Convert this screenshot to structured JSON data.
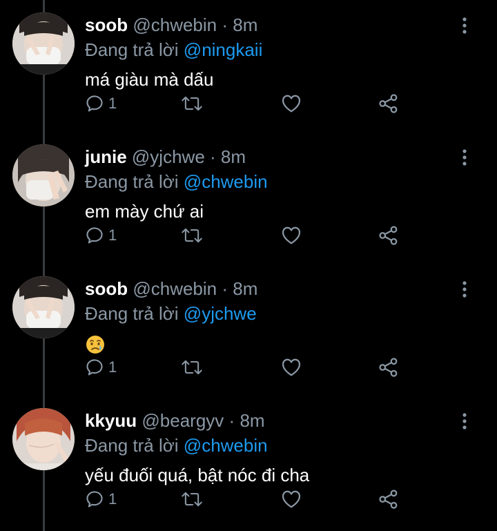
{
  "tweets": [
    {
      "name": "soob",
      "handle": "@chwebin",
      "separator": "·",
      "time": "8m",
      "reply_prefix": "Đang trả lời",
      "reply_to": "@ningkaii",
      "text": "má giàu mà dấu",
      "reply_count": "1",
      "avatar": "soob-avatar"
    },
    {
      "name": "junie",
      "handle": "@yjchwe",
      "separator": "·",
      "time": "8m",
      "reply_prefix": "Đang trả lời",
      "reply_to": "@chwebin",
      "text": "em mày chứ ai",
      "reply_count": "1",
      "avatar": "junie-avatar"
    },
    {
      "name": "soob",
      "handle": "@chwebin",
      "separator": "·",
      "time": "8m",
      "reply_prefix": "Đang trả lời",
      "reply_to": "@yjchwe",
      "text": "",
      "emoji": "crying-face-emoji",
      "reply_count": "1",
      "avatar": "soob-avatar"
    },
    {
      "name": "kkyuu",
      "handle": "@beargyv",
      "separator": "·",
      "time": "8m",
      "reply_prefix": "Đang trả lời",
      "reply_to": "@chwebin",
      "text": "yếu đuối quá, bật nóc đi cha",
      "reply_count": "1",
      "avatar": "kkyuu-avatar"
    }
  ],
  "icons": {
    "reply": "reply-icon",
    "retweet": "retweet-icon",
    "like": "heart-icon",
    "share": "share-icon",
    "more": "more-vertical-icon"
  },
  "colors": {
    "background": "#000000",
    "text": "#ffffff",
    "secondary": "#8b98a5",
    "mention": "#1d9bf0",
    "thread_line": "#3a3d40"
  }
}
